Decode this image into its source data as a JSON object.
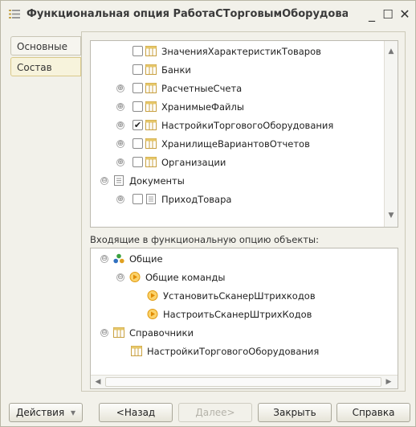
{
  "window": {
    "title": "Функциональная опция РаботаСТорговымОборудован...",
    "minimize": "_",
    "maximize": "☐",
    "close": "✕"
  },
  "tabs": [
    {
      "label": "Основные",
      "active": false
    },
    {
      "label": "Состав",
      "active": true
    }
  ],
  "top_tree": {
    "rows": [
      {
        "label": "ЗначенияХарактеристикТоваров",
        "expander": "",
        "checked": false,
        "icon": "catalog-icon"
      },
      {
        "label": "Банки",
        "expander": "",
        "checked": false,
        "icon": "catalog-icon"
      },
      {
        "label": "РасчетныеСчета",
        "expander": "⊕",
        "checked": false,
        "icon": "catalog-icon"
      },
      {
        "label": "ХранимыеФайлы",
        "expander": "⊕",
        "checked": false,
        "icon": "catalog-icon"
      },
      {
        "label": "НастройкиТорговогоОборудования",
        "expander": "⊕",
        "checked": true,
        "icon": "catalog-icon"
      },
      {
        "label": "ХранилищеВариантовОтчетов",
        "expander": "⊕",
        "checked": false,
        "icon": "catalog-icon"
      },
      {
        "label": "Организации",
        "expander": "⊕",
        "checked": false,
        "icon": "catalog-icon"
      },
      {
        "label": "Документы",
        "expander": "⊖",
        "checked": null,
        "icon": "document-icon"
      },
      {
        "label": "ПриходТовара",
        "expander": "⊕",
        "checked": false,
        "icon": "document-icon"
      }
    ]
  },
  "section_label": "Входящие в функциональную опцию объекты:",
  "bottom_tree": {
    "rows": [
      {
        "label": "Общие",
        "expander": "⊖",
        "icon": "common-icon"
      },
      {
        "label": "Общие команды",
        "expander": "⊖",
        "icon": "command-group-icon"
      },
      {
        "label": "УстановитьСканерШтрихкодов",
        "expander": "",
        "icon": "command-icon"
      },
      {
        "label": "НастроитьСканерШтрихКодов",
        "expander": "",
        "icon": "command-icon"
      },
      {
        "label": "Справочники",
        "expander": "⊖",
        "icon": "catalog-icon"
      },
      {
        "label": "НастройкиТорговогоОборудования",
        "expander": "",
        "icon": "catalog-icon"
      }
    ]
  },
  "footer": {
    "actions": "Действия",
    "actions_arrow": "▾",
    "back": "<Назад",
    "next": "Далее>",
    "close": "Закрыть",
    "help": "Справка"
  },
  "colors": {
    "window_bg": "#f2f1ea",
    "active_tab": "#f7f3dc",
    "catalog_icon": "#c8a040",
    "command_icon": "#f0a018",
    "common_green": "#3aa040",
    "common_blue": "#3070c0"
  }
}
